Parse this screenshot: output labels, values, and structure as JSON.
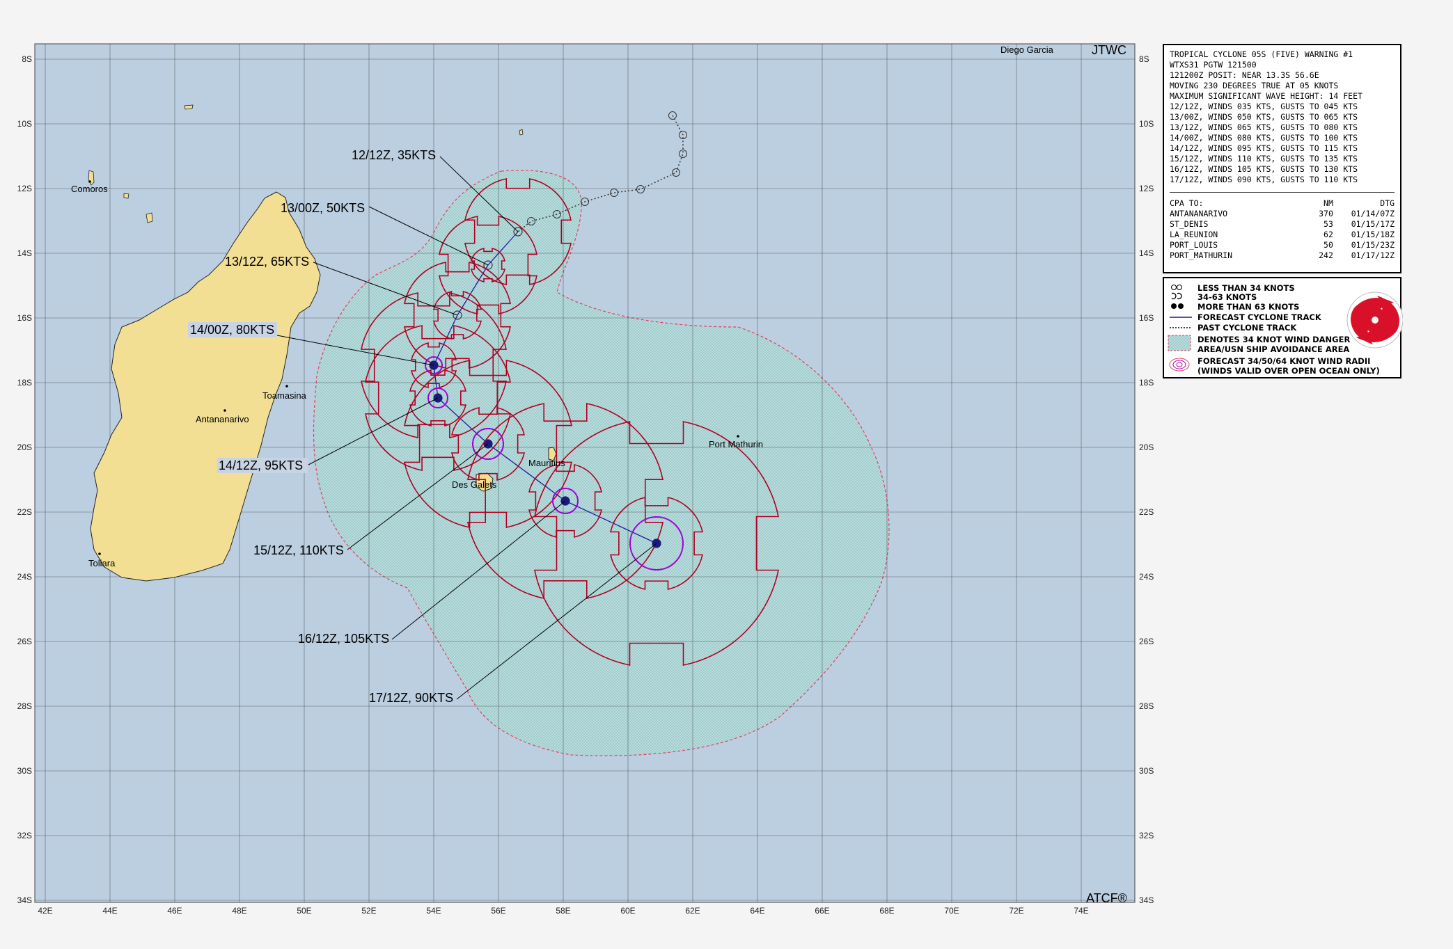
{
  "map": {
    "agency_label": "JTWC",
    "software_label": "ATCF®",
    "lon_labels": [
      "42E",
      "44E",
      "46E",
      "48E",
      "50E",
      "52E",
      "54E",
      "56E",
      "58E",
      "60E",
      "62E",
      "64E",
      "66E",
      "68E",
      "70E",
      "72E",
      "74E"
    ],
    "lat_labels": [
      "8S",
      "10S",
      "12S",
      "14S",
      "16S",
      "18S",
      "20S",
      "22S",
      "24S",
      "26S",
      "28S",
      "30S",
      "32S",
      "34S"
    ],
    "colors": {
      "ocean": "#bccfe0",
      "land": "#f2df94",
      "danger_area": "#a9d3d6",
      "wind_radii_34": "#b00020",
      "wind_radii_64": "#a000d8",
      "track": "#1a1a9c"
    },
    "place_names": {
      "diego_garcia": "Diego Garcia",
      "comoros": "Comoros",
      "toamasina": "Toamasina",
      "antananarivo": "Antananarivo",
      "toliara": "Toliara",
      "mauritius": "Mauritius",
      "des_galets": "Des Galets",
      "port_mathurin": "Port Mathurin"
    },
    "forecast_labels": [
      "12/12Z,  35KTS",
      "13/00Z,  50KTS",
      "13/12Z,  65KTS",
      "14/00Z,  80KTS",
      "14/12Z,  95KTS",
      "15/12Z, 110KTS",
      "16/12Z, 105KTS",
      "17/12Z,  90KTS"
    ]
  },
  "warning": {
    "lines": [
      "TROPICAL CYCLONE 05S (FIVE) WARNING #1",
      "WTXS31 PGTW 121500",
      "121200Z POSIT: NEAR 13.3S 56.6E",
      "MOVING 230 DEGREES TRUE AT 05 KNOTS",
      "MAXIMUM SIGNIFICANT WAVE HEIGHT: 14 FEET",
      "12/12Z, WINDS 035 KTS, GUSTS TO 045 KTS",
      "13/00Z, WINDS 050 KTS, GUSTS TO 065 KTS",
      "13/12Z, WINDS 065 KTS, GUSTS TO 080 KTS",
      "14/00Z, WINDS 080 KTS, GUSTS TO 100 KTS",
      "14/12Z, WINDS 095 KTS, GUSTS TO 115 KTS",
      "15/12Z, WINDS 110 KTS, GUSTS TO 135 KTS",
      "16/12Z, WINDS 105 KTS, GUSTS TO 130 KTS",
      "17/12Z, WINDS 090 KTS, GUSTS TO 110 KTS"
    ],
    "cpa_header": [
      "CPA TO:",
      "NM",
      "DTG"
    ],
    "cpa_rows": [
      [
        "ANTANANARIVO",
        "370",
        "01/14/07Z"
      ],
      [
        "ST_DENIS",
        "53",
        "01/15/17Z"
      ],
      [
        "LA_REUNION",
        "62",
        "01/15/18Z"
      ],
      [
        "PORT_LOUIS",
        "50",
        "01/15/23Z"
      ],
      [
        "PORT_MATHURIN",
        "242",
        "01/17/12Z"
      ]
    ]
  },
  "legend": {
    "items": [
      "LESS THAN 34 KNOTS",
      "34-63 KNOTS",
      "MORE THAN 63 KNOTS",
      "FORECAST CYCLONE TRACK",
      "PAST CYCLONE TRACK",
      "DENOTES 34 KNOT WIND DANGER",
      "AREA/USN SHIP AVOIDANCE AREA",
      "FORECAST 34/50/64 KNOT WIND RADII",
      "(WINDS VALID OVER OPEN OCEAN ONLY)"
    ]
  }
}
